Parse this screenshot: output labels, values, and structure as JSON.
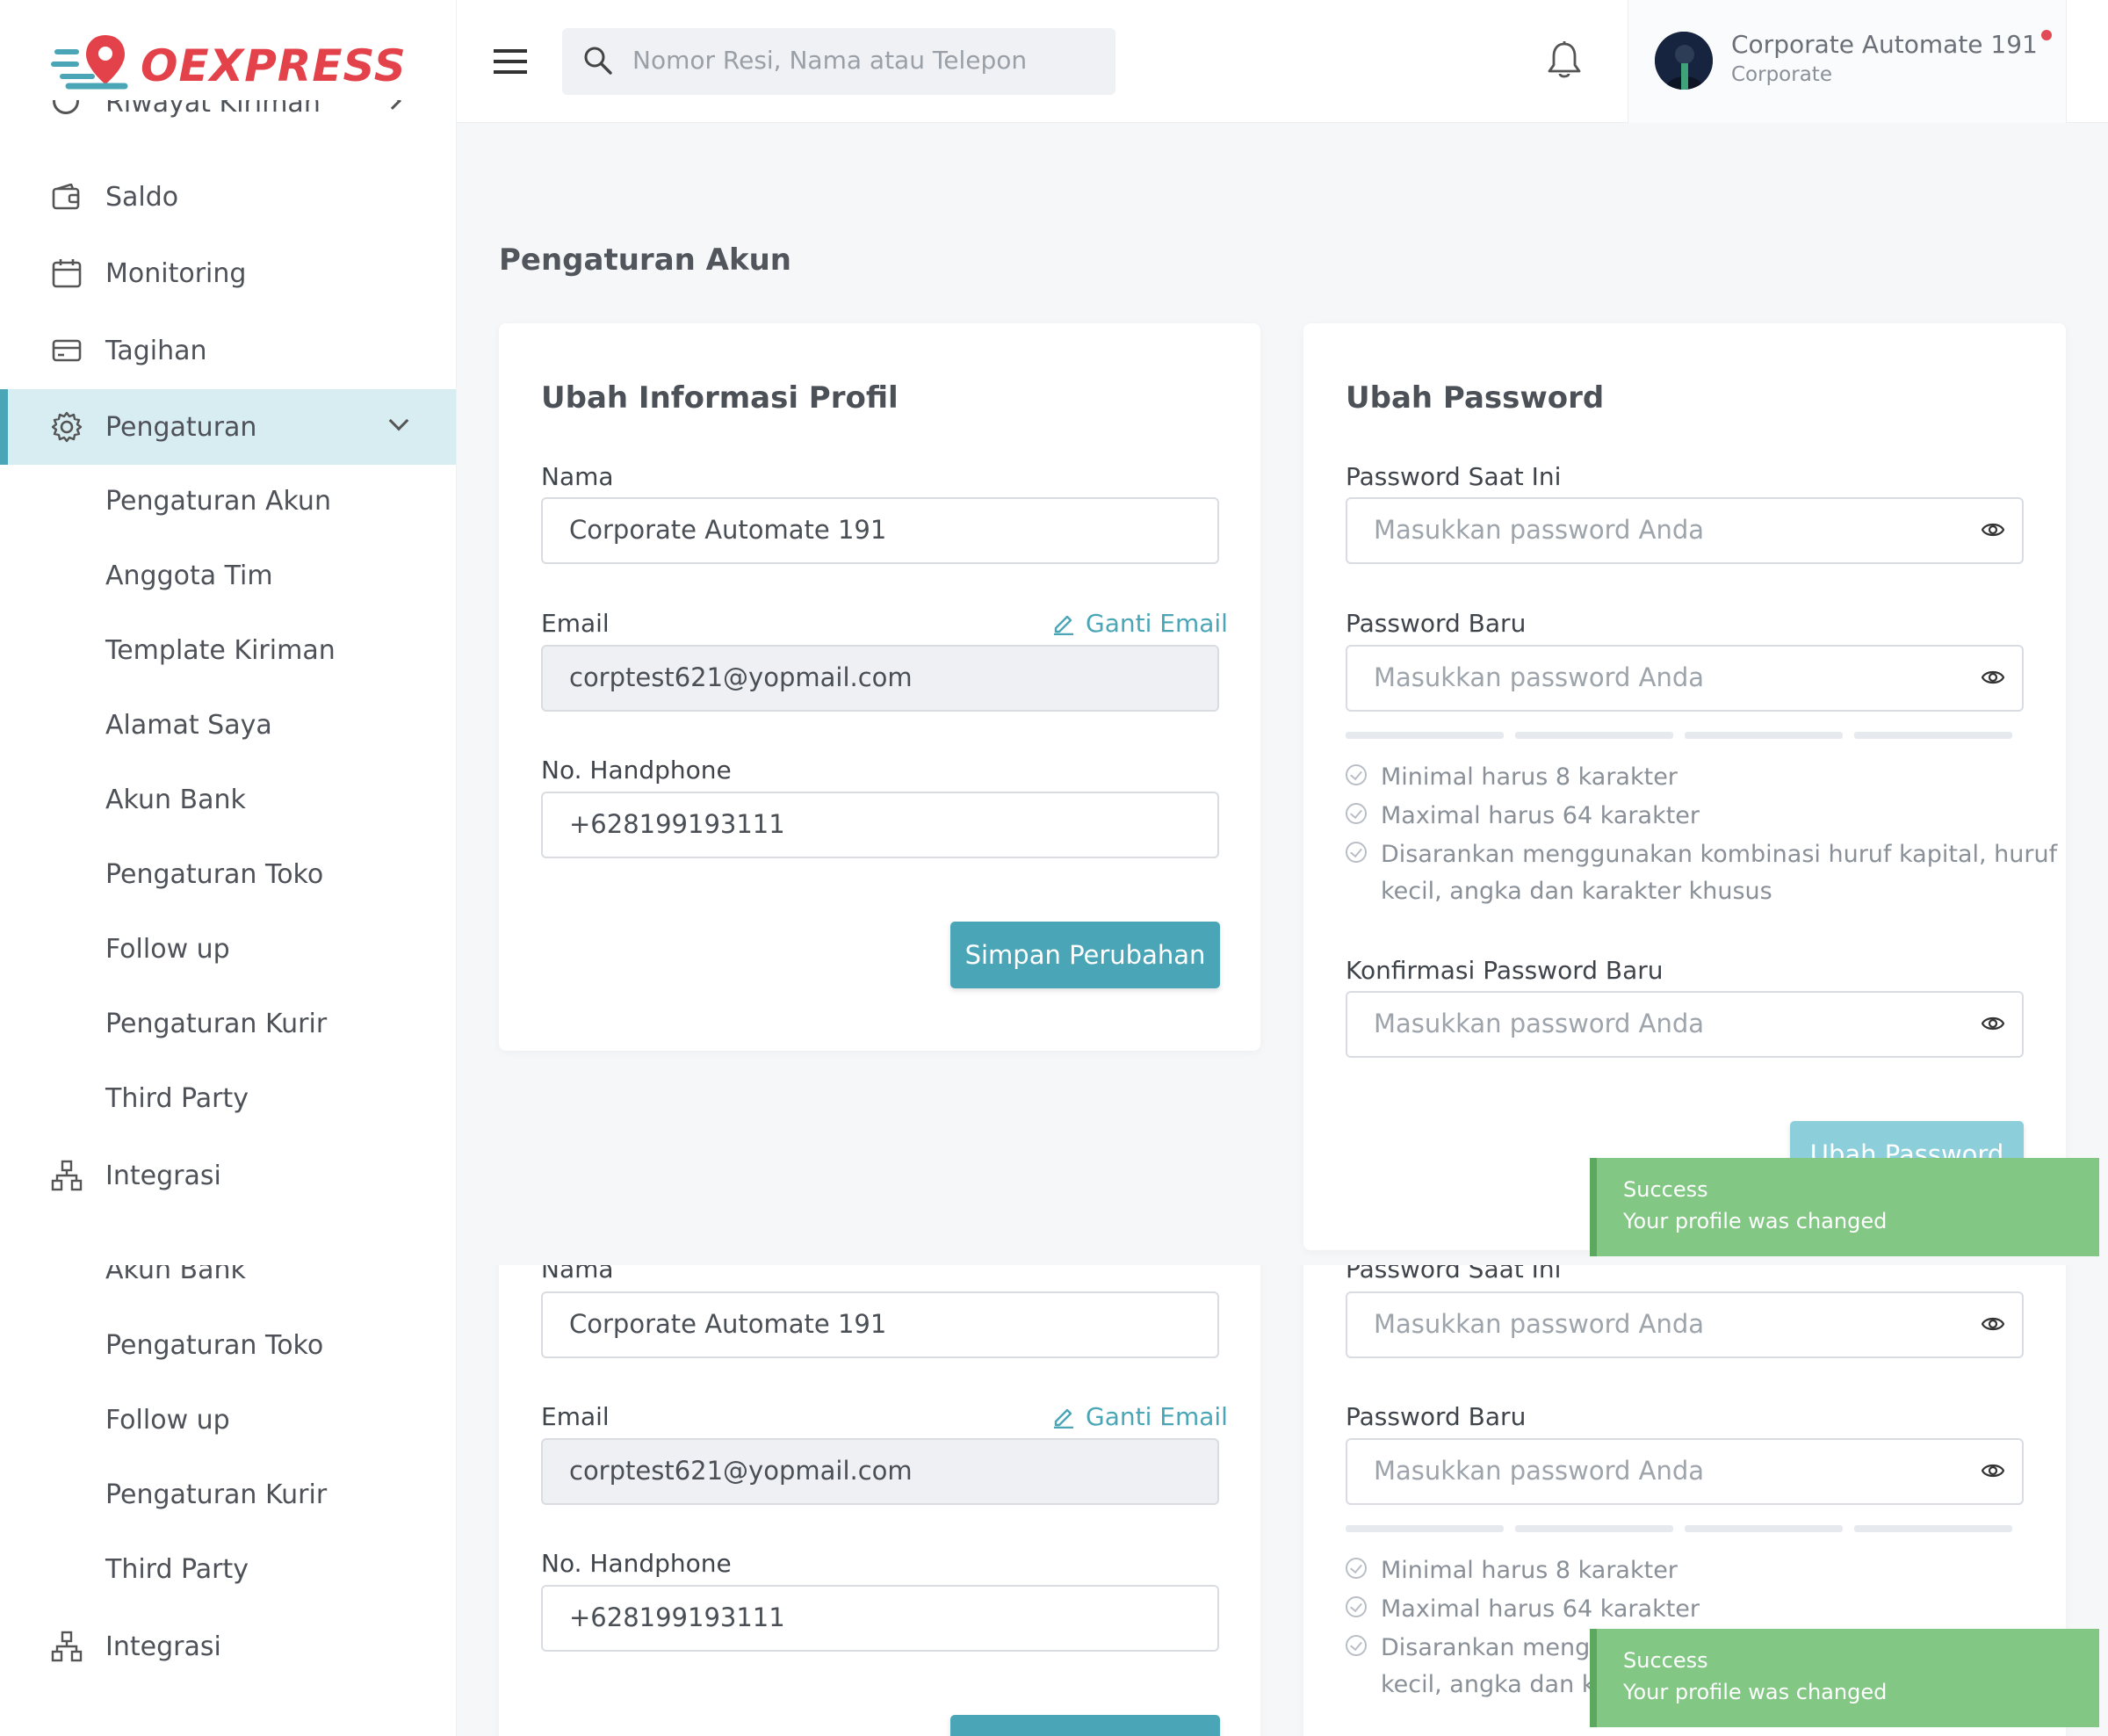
{
  "brand": {
    "logo_text": "OEXPRESS",
    "colors": {
      "brand": "#e3424a",
      "accent": "#4aa6b7",
      "toast": "#82c784"
    }
  },
  "header": {
    "search_placeholder": "Nomor Resi, Nama atau Telepon",
    "user_name": "Corporate Automate 191",
    "user_role": "Corporate"
  },
  "sidebar": {
    "partial_item": "Riwayat Kiriman",
    "items": [
      {
        "label": "Saldo",
        "icon": "wallet-icon"
      },
      {
        "label": "Monitoring",
        "icon": "calendar-icon"
      },
      {
        "label": "Tagihan",
        "icon": "card-icon"
      },
      {
        "label": "Pengaturan",
        "icon": "gear-icon"
      }
    ],
    "sub_items": [
      "Pengaturan Akun",
      "Anggota Tim",
      "Template Kiriman",
      "Alamat Saya",
      "Akun Bank",
      "Pengaturan Toko",
      "Follow up",
      "Pengaturan Kurir",
      "Third Party"
    ],
    "integrasi": "Integrasi"
  },
  "page_title": "Pengaturan Akun",
  "profile_card": {
    "title": "Ubah Informasi Profil",
    "name_label": "Nama",
    "name_value": "Corporate Automate 191",
    "email_label": "Email",
    "change_email": "Ganti Email",
    "email_value": "corptest621@yopmail.com",
    "phone_label": "No. Handphone",
    "phone_value": "+628199193111",
    "save_button": "Simpan Perubahan"
  },
  "password_card": {
    "title": "Ubah Password",
    "current_label": "Password Saat Ini",
    "new_label": "Password Baru",
    "confirm_label": "Konfirmasi Password Baru",
    "placeholder": "Masukkan password Anda",
    "rules": [
      "Minimal harus 8 karakter",
      "Maximal harus 64 karakter",
      "Disarankan menggunakan kombinasi huruf kapital, huruf",
      "kecil, angka dan karakter khusus"
    ],
    "rules_cut": [
      "Disarankan mengg",
      "kecil, angka dan ka"
    ],
    "submit_button": "Ubah Password"
  },
  "toast": {
    "title": "Success",
    "message": "Your profile was changed"
  }
}
